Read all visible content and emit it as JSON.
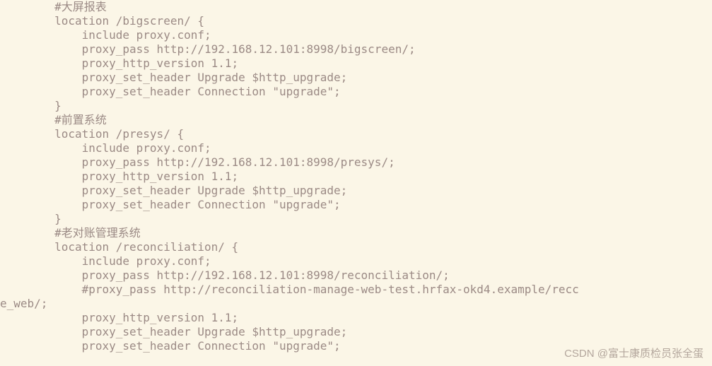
{
  "code_lines": [
    "        #大屏报表",
    "        location /bigscreen/ {",
    "            include proxy.conf;",
    "            proxy_pass http://192.168.12.101:8998/bigscreen/;",
    "            proxy_http_version 1.1;",
    "            proxy_set_header Upgrade $http_upgrade;",
    "            proxy_set_header Connection \"upgrade\";",
    "        }",
    "        #前置系统",
    "        location /presys/ {",
    "            include proxy.conf;",
    "            proxy_pass http://192.168.12.101:8998/presys/;",
    "            proxy_http_version 1.1;",
    "            proxy_set_header Upgrade $http_upgrade;",
    "            proxy_set_header Connection \"upgrade\";",
    "        }",
    "        #老对账管理系统",
    "        location /reconciliation/ {",
    "            include proxy.conf;",
    "            proxy_pass http://192.168.12.101:8998/reconciliation/;",
    "            #proxy_pass http://reconciliation-manage-web-test.hrfax-okd4.example/recc",
    "e_web/;",
    "            proxy_http_version 1.1;",
    "            proxy_set_header Upgrade $http_upgrade;",
    "            proxy_set_header Connection \"upgrade\";"
  ],
  "watermark": "CSDN @富士康质检员张全蛋"
}
